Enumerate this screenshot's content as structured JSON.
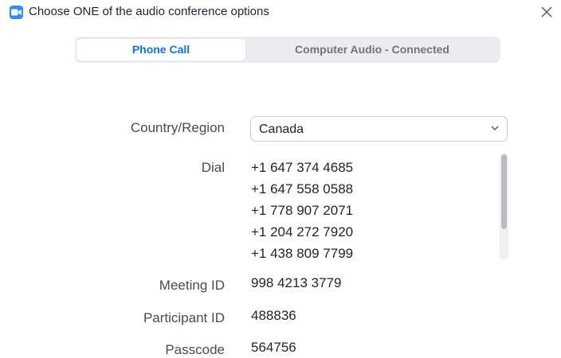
{
  "window": {
    "title": "Choose ONE of the audio conference options",
    "app_icon": "zoom-camera-icon",
    "close_icon": "close-icon"
  },
  "tabs": [
    {
      "label": "Phone Call",
      "active": true
    },
    {
      "label": "Computer Audio - Connected",
      "active": false
    }
  ],
  "country": {
    "label": "Country/Region",
    "value": "Canada",
    "icon": "chevron-down-icon"
  },
  "dial": {
    "label": "Dial",
    "numbers": [
      "+1 647 374 4685",
      "+1 647 558 0588",
      "+1 778 907 2071",
      "+1 204 272 7920",
      "+1 438 809 7799"
    ]
  },
  "meeting": {
    "meeting_id_label": "Meeting ID",
    "meeting_id": "998 4213 3779",
    "participant_id_label": "Participant ID",
    "participant_id": "488836",
    "passcode_label": "Passcode",
    "passcode": "564756"
  },
  "colors": {
    "accent": "#0e72ed",
    "app_icon": "#2d8cff",
    "tab_background": "#ececf0",
    "inactive_tab_text": "#6e7680"
  }
}
